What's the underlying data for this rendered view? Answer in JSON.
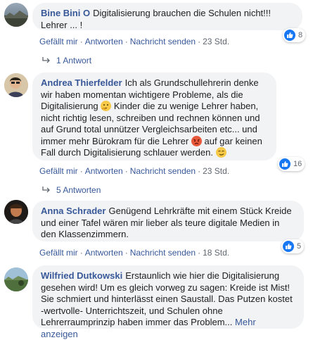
{
  "actions": {
    "like": "Gefällt mir",
    "reply": "Antworten",
    "message": "Nachricht senden",
    "sep": "·"
  },
  "comments": [
    {
      "author": "Bine Bini O",
      "text": "Digitalisierung brauchen die Schulen nicht!!! Lehrer ... !",
      "time": "23 Std.",
      "likes": "8",
      "replies": "1 Antwort",
      "avatar_icon": "landscape-avatar"
    },
    {
      "author": "Andrea Thierfelder",
      "text_1": "Ich als Grundschullehrerin denke wir haben momentan wichtigere Probleme, als die Digitalisierung",
      "text_2": "Kinder die zu wenige Lehrer haben, nicht richtig lesen, schreiben und rechnen können und auf Grund total unnützer Vergleichsarbeiten etc... und immer mehr Bürokram für die Lehrer",
      "text_3": "auf gar keinen Fall durch Digitalisierung schlauer werden.",
      "time": "23 Std.",
      "likes": "16",
      "replies": "5 Antworten",
      "avatar_icon": "person-avatar"
    },
    {
      "author": "Anna Schrader",
      "text": "Genügend Lehrkräfte mit einem Stück Kreide und einer Tafel wären mir lieber als teure digitale Medien in den Klassenzimmern.",
      "time": "18 Std.",
      "likes": "5",
      "avatar_icon": "dark-avatar"
    },
    {
      "author": "Wilfried Dutkowski",
      "text": "Erstaunlich wie hier die Digitalisierung gesehen wird! Um es gleich vorweg zu sagen: Kreide ist Mist! Sie schmiert und hinterlässt einen Saustall. Das Putzen kostet -wertvolle- Unterrichtszeit, und Schulen ohne Lehrerraumprinzip haben immer das Problem...",
      "more": "Mehr anzeigen",
      "avatar_icon": "nature-avatar"
    }
  ],
  "colors": {
    "link": "#385898",
    "bubble": "#f2f3f5",
    "like_blue": "#1877f2",
    "meta": "#606770"
  }
}
